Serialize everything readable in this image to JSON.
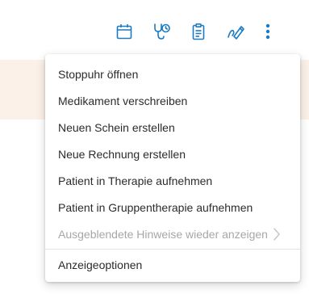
{
  "colors": {
    "accent": "#1a7ac4",
    "band": "#fbf1e8",
    "text": "#2b2b2b",
    "disabled_text": "#a7a7a7"
  },
  "toolbar": {
    "icons": [
      "calendar-icon",
      "stethoscope-clock-icon",
      "clipboard-icon",
      "signature-pen-icon",
      "more-vertical-icon"
    ]
  },
  "menu": {
    "items": [
      {
        "label": "Stoppuhr öffnen",
        "enabled": true
      },
      {
        "label": "Medikament verschreiben",
        "enabled": true
      },
      {
        "label": "Neuen Schein erstellen",
        "enabled": true
      },
      {
        "label": "Neue Rechnung erstellen",
        "enabled": true
      },
      {
        "label": "Patient in Therapie aufnehmen",
        "enabled": true
      },
      {
        "label": "Patient in Gruppentherapie aufnehmen",
        "enabled": true
      },
      {
        "label": "Ausgeblendete Hinweise wieder anzeigen",
        "enabled": false,
        "submenu": true
      }
    ],
    "footer_item": {
      "label": "Anzeigeoptionen",
      "enabled": true
    }
  }
}
